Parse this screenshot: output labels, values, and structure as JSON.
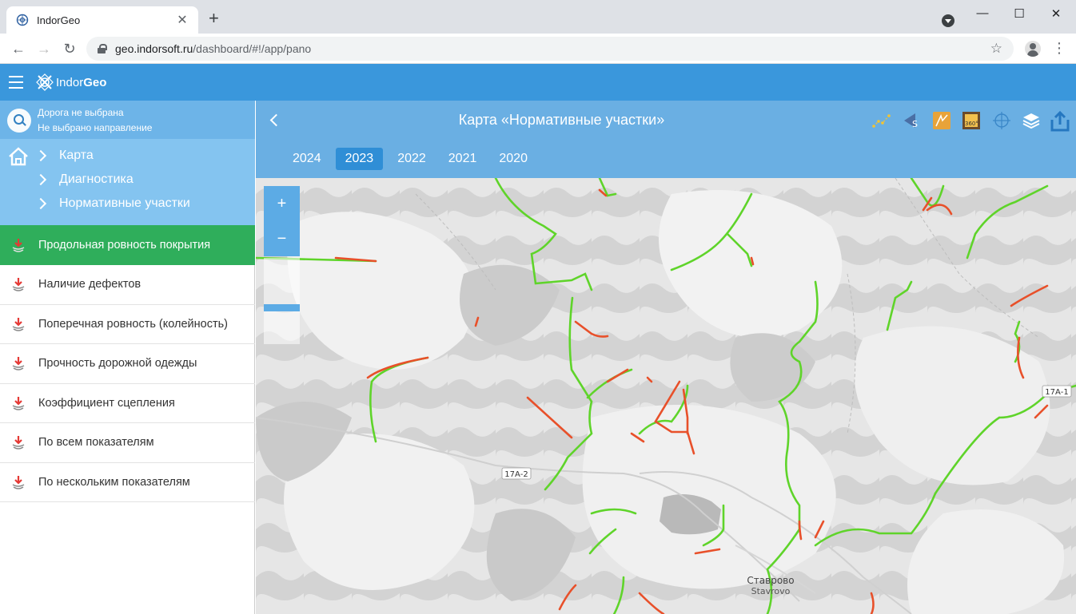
{
  "browser": {
    "tab_title": "IndorGeo",
    "url_host": "geo.indorsoft.ru",
    "url_path": "/dashboard/#!/app/pano"
  },
  "app": {
    "logo_prefix": "Indor",
    "logo_suffix": "Geo",
    "accent_color": "#3a97dc"
  },
  "sidebar": {
    "road_line1": "Дорога не выбрана",
    "road_line2": "Не выбрано направление",
    "breadcrumbs": [
      "Карта",
      "Диагностика",
      "Нормативные участки"
    ],
    "items": [
      {
        "label": "Продольная ровность покрытия",
        "active": true
      },
      {
        "label": "Наличие дефектов"
      },
      {
        "label": "Поперечная ровность (колейность)"
      },
      {
        "label": "Прочность дорожной одежды"
      },
      {
        "label": "Коэффициент сцепления"
      },
      {
        "label": "По всем показателям"
      },
      {
        "label": "По нескольким показателям"
      }
    ]
  },
  "map_header": {
    "title": "Карта «Нормативные участки»",
    "years": [
      "2024",
      "2023",
      "2022",
      "2021",
      "2020"
    ],
    "selected_year": "2023",
    "tools": [
      "points-icon",
      "road-sign-icon",
      "map-sign-icon",
      "panorama-360-icon",
      "crosshair-icon",
      "layers-icon",
      "share-icon"
    ]
  },
  "map": {
    "zoom_in": "+",
    "zoom_out": "−",
    "road_labels": [
      "17А-2",
      "17А-1"
    ],
    "place_ru": "Ставрово",
    "place_en": "Stavrovo",
    "good_color": "#5fd42a",
    "bad_color": "#e8502a"
  }
}
